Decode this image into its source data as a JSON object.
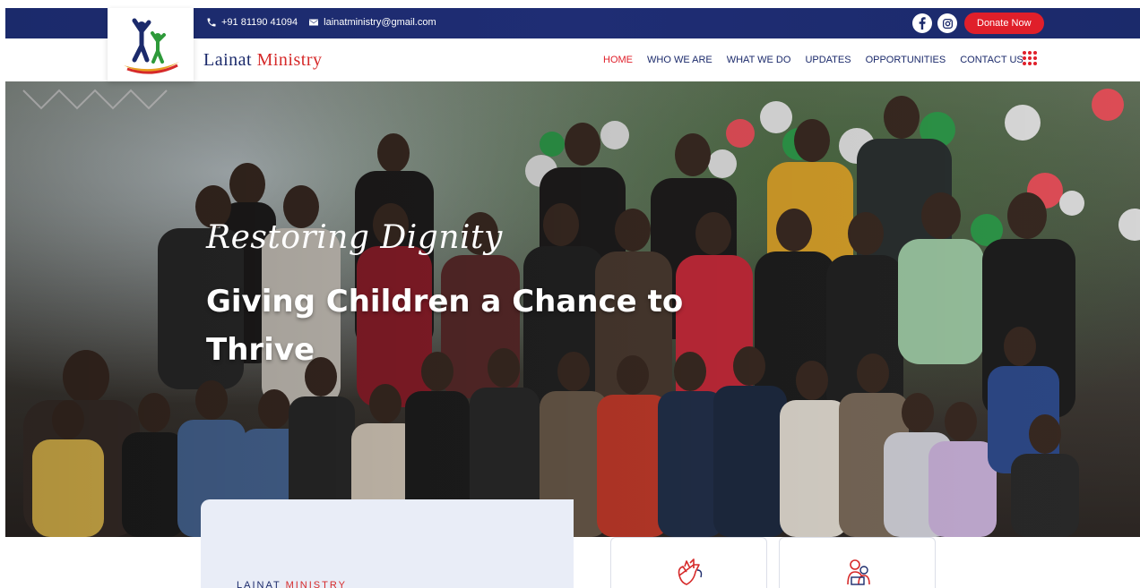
{
  "topbar": {
    "phone": "+91 81190 41094",
    "email": "lainatministry@gmail.com",
    "donate_label": "Donate Now",
    "social": [
      "facebook-icon",
      "instagram-icon"
    ]
  },
  "brand": {
    "first": "Lainat",
    "second": "Ministry"
  },
  "nav": {
    "items": [
      {
        "label": "HOME",
        "active": true
      },
      {
        "label": "WHO WE ARE",
        "active": false
      },
      {
        "label": "WHAT WE DO",
        "active": false
      },
      {
        "label": "UPDATES",
        "active": false
      },
      {
        "label": "OPPORTUNITIES",
        "active": false
      },
      {
        "label": "CONTACT US",
        "active": false
      }
    ]
  },
  "hero": {
    "script": "Restoring Dignity",
    "title": "Giving Children a Chance to Thrive"
  },
  "about": {
    "label_first": "LAINAT",
    "label_second": "MINISTRY"
  },
  "features": [
    {
      "icon": "helping-hands-icon"
    },
    {
      "icon": "mother-child-icon"
    }
  ],
  "colors": {
    "navy": "#1b2a6b",
    "accent": "#e01f2a"
  }
}
